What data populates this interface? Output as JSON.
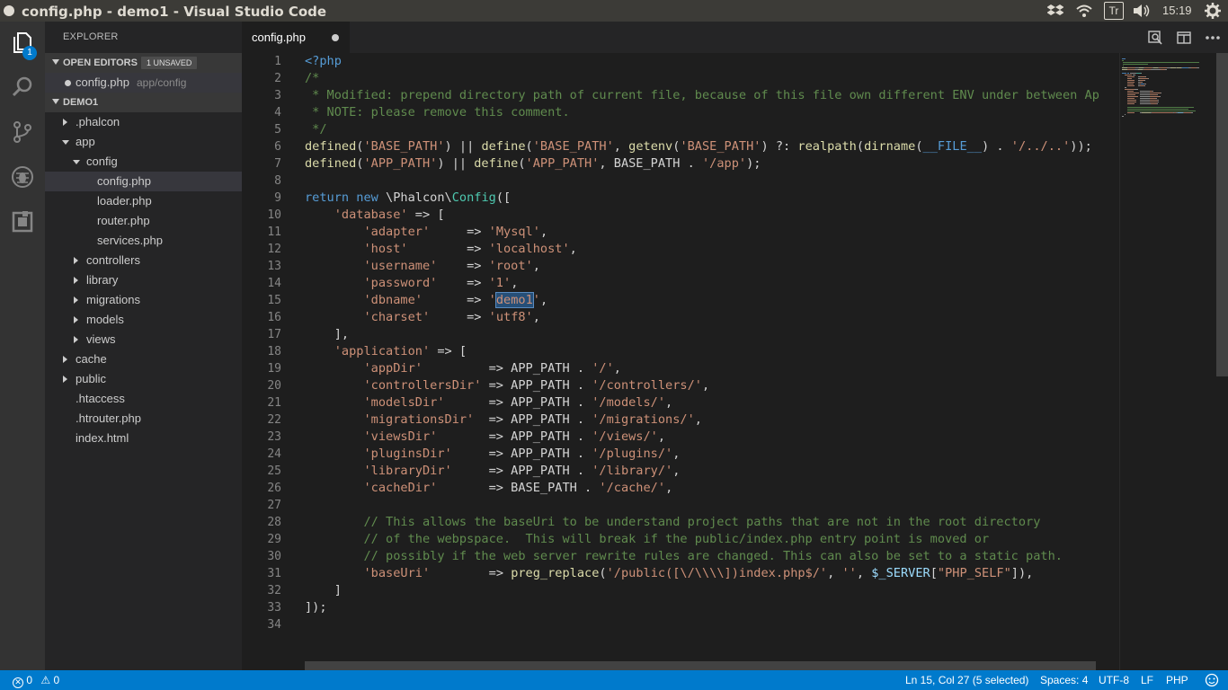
{
  "window": {
    "title": "config.php - demo1 - Visual Studio Code"
  },
  "system_tray": {
    "time": "15:19",
    "keyboard_indicator": "Tr"
  },
  "activity_bar": {
    "explorer_badge": "1",
    "icons": [
      "files-icon",
      "search-icon",
      "source-control-icon",
      "debug-icon",
      "extensions-icon"
    ]
  },
  "sidebar": {
    "header": "EXPLORER",
    "open_editors": {
      "label": "OPEN EDITORS",
      "badge": "1 UNSAVED",
      "file": "config.php",
      "path": "app/config"
    },
    "project": {
      "label": "DEMO1",
      "items": [
        {
          "name": ".phalcon"
        },
        {
          "name": "app"
        },
        {
          "name": "config"
        },
        {
          "name": "config.php"
        },
        {
          "name": "loader.php"
        },
        {
          "name": "router.php"
        },
        {
          "name": "services.php"
        },
        {
          "name": "controllers"
        },
        {
          "name": "library"
        },
        {
          "name": "migrations"
        },
        {
          "name": "models"
        },
        {
          "name": "views"
        },
        {
          "name": "cache"
        },
        {
          "name": "public"
        },
        {
          "name": ".htaccess"
        },
        {
          "name": ".htrouter.php"
        },
        {
          "name": "index.html"
        }
      ]
    }
  },
  "tabs": [
    {
      "label": "config.php",
      "dirty": true
    }
  ],
  "editor": {
    "line_numbers": [
      "1",
      "2",
      "3",
      "4",
      "5",
      "6",
      "7",
      "8",
      "9",
      "10",
      "11",
      "12",
      "13",
      "14",
      "15",
      "16",
      "17",
      "18",
      "19",
      "20",
      "21",
      "22",
      "23",
      "24",
      "25",
      "26",
      "27",
      "28",
      "29",
      "30",
      "31",
      "32",
      "33",
      "34"
    ],
    "lines": [
      [
        [
          "kw",
          "<?php"
        ]
      ],
      [
        [
          "cm",
          "/*"
        ]
      ],
      [
        [
          "cm",
          " * Modified: prepend directory path of current file, because of this file own different ENV under between Ap"
        ]
      ],
      [
        [
          "cm",
          " * NOTE: please remove this comment."
        ]
      ],
      [
        [
          "cm",
          " */"
        ]
      ],
      [
        [
          "fn",
          "defined"
        ],
        [
          "tx",
          "("
        ],
        [
          "st",
          "'BASE_PATH'"
        ],
        [
          "tx",
          ") || "
        ],
        [
          "fn",
          "define"
        ],
        [
          "tx",
          "("
        ],
        [
          "st",
          "'BASE_PATH'"
        ],
        [
          "tx",
          ", "
        ],
        [
          "fn",
          "getenv"
        ],
        [
          "tx",
          "("
        ],
        [
          "st",
          "'BASE_PATH'"
        ],
        [
          "tx",
          ") ?: "
        ],
        [
          "fn",
          "realpath"
        ],
        [
          "tx",
          "("
        ],
        [
          "fn",
          "dirname"
        ],
        [
          "tx",
          "("
        ],
        [
          "kw",
          "__FILE__"
        ],
        [
          "tx",
          ") . "
        ],
        [
          "st",
          "'/../..'"
        ],
        [
          "tx",
          "));"
        ]
      ],
      [
        [
          "fn",
          "defined"
        ],
        [
          "tx",
          "("
        ],
        [
          "st",
          "'APP_PATH'"
        ],
        [
          "tx",
          ") || "
        ],
        [
          "fn",
          "define"
        ],
        [
          "tx",
          "("
        ],
        [
          "st",
          "'APP_PATH'"
        ],
        [
          "tx",
          ", BASE_PATH . "
        ],
        [
          "st",
          "'/app'"
        ],
        [
          "tx",
          ");"
        ]
      ],
      [],
      [
        [
          "kw",
          "return"
        ],
        [
          "tx",
          " "
        ],
        [
          "kw",
          "new"
        ],
        [
          "tx",
          " \\Phalcon\\"
        ],
        [
          "cl",
          "Config"
        ],
        [
          "tx",
          "(["
        ]
      ],
      [
        [
          "tx",
          "    "
        ],
        [
          "st",
          "'database'"
        ],
        [
          "tx",
          " => ["
        ]
      ],
      [
        [
          "tx",
          "        "
        ],
        [
          "st",
          "'adapter'"
        ],
        [
          "tx",
          "     => "
        ],
        [
          "st",
          "'Mysql'"
        ],
        [
          "tx",
          ","
        ]
      ],
      [
        [
          "tx",
          "        "
        ],
        [
          "st",
          "'host'"
        ],
        [
          "tx",
          "        => "
        ],
        [
          "st",
          "'localhost'"
        ],
        [
          "tx",
          ","
        ]
      ],
      [
        [
          "tx",
          "        "
        ],
        [
          "st",
          "'username'"
        ],
        [
          "tx",
          "    => "
        ],
        [
          "st",
          "'root'"
        ],
        [
          "tx",
          ","
        ]
      ],
      [
        [
          "tx",
          "        "
        ],
        [
          "st",
          "'password'"
        ],
        [
          "tx",
          "    => "
        ],
        [
          "st",
          "'1'"
        ],
        [
          "tx",
          ","
        ]
      ],
      [
        [
          "tx",
          "        "
        ],
        [
          "st",
          "'dbname'"
        ],
        [
          "tx",
          "      => "
        ],
        [
          "st",
          "'"
        ],
        [
          "sel",
          "demo1"
        ],
        [
          "st",
          "'"
        ],
        [
          "tx",
          ","
        ]
      ],
      [
        [
          "tx",
          "        "
        ],
        [
          "st",
          "'charset'"
        ],
        [
          "tx",
          "     => "
        ],
        [
          "st",
          "'utf8'"
        ],
        [
          "tx",
          ","
        ]
      ],
      [
        [
          "tx",
          "    ],"
        ]
      ],
      [
        [
          "tx",
          "    "
        ],
        [
          "st",
          "'application'"
        ],
        [
          "tx",
          " => ["
        ]
      ],
      [
        [
          "tx",
          "        "
        ],
        [
          "st",
          "'appDir'"
        ],
        [
          "tx",
          "         => APP_PATH . "
        ],
        [
          "st",
          "'/'"
        ],
        [
          "tx",
          ","
        ]
      ],
      [
        [
          "tx",
          "        "
        ],
        [
          "st",
          "'controllersDir'"
        ],
        [
          "tx",
          " => APP_PATH . "
        ],
        [
          "st",
          "'/controllers/'"
        ],
        [
          "tx",
          ","
        ]
      ],
      [
        [
          "tx",
          "        "
        ],
        [
          "st",
          "'modelsDir'"
        ],
        [
          "tx",
          "      => APP_PATH . "
        ],
        [
          "st",
          "'/models/'"
        ],
        [
          "tx",
          ","
        ]
      ],
      [
        [
          "tx",
          "        "
        ],
        [
          "st",
          "'migrationsDir'"
        ],
        [
          "tx",
          "  => APP_PATH . "
        ],
        [
          "st",
          "'/migrations/'"
        ],
        [
          "tx",
          ","
        ]
      ],
      [
        [
          "tx",
          "        "
        ],
        [
          "st",
          "'viewsDir'"
        ],
        [
          "tx",
          "       => APP_PATH . "
        ],
        [
          "st",
          "'/views/'"
        ],
        [
          "tx",
          ","
        ]
      ],
      [
        [
          "tx",
          "        "
        ],
        [
          "st",
          "'pluginsDir'"
        ],
        [
          "tx",
          "     => APP_PATH . "
        ],
        [
          "st",
          "'/plugins/'"
        ],
        [
          "tx",
          ","
        ]
      ],
      [
        [
          "tx",
          "        "
        ],
        [
          "st",
          "'libraryDir'"
        ],
        [
          "tx",
          "     => APP_PATH . "
        ],
        [
          "st",
          "'/library/'"
        ],
        [
          "tx",
          ","
        ]
      ],
      [
        [
          "tx",
          "        "
        ],
        [
          "st",
          "'cacheDir'"
        ],
        [
          "tx",
          "       => BASE_PATH . "
        ],
        [
          "st",
          "'/cache/'"
        ],
        [
          "tx",
          ","
        ]
      ],
      [],
      [
        [
          "cm",
          "        // This allows the baseUri to be understand project paths that are not in the root directory"
        ]
      ],
      [
        [
          "cm",
          "        // of the webpspace.  This will break if the public/index.php entry point is moved or"
        ]
      ],
      [
        [
          "cm",
          "        // possibly if the web server rewrite rules are changed. This can also be set to a static path."
        ]
      ],
      [
        [
          "tx",
          "        "
        ],
        [
          "st",
          "'baseUri'"
        ],
        [
          "tx",
          "        => "
        ],
        [
          "fn",
          "preg_replace"
        ],
        [
          "tx",
          "("
        ],
        [
          "st",
          "'/public([\\/\\\\\\\\])index.php$/'"
        ],
        [
          "tx",
          ", "
        ],
        [
          "st",
          "''"
        ],
        [
          "tx",
          ", "
        ],
        [
          "vr",
          "$_SERVER"
        ],
        [
          "tx",
          "["
        ],
        [
          "st",
          "\"PHP_SELF\""
        ],
        [
          "tx",
          "]),"
        ]
      ],
      [
        [
          "tx",
          "    ]"
        ]
      ],
      [
        [
          "tx",
          "]);"
        ]
      ],
      []
    ]
  },
  "status_bar": {
    "errors": "0",
    "warnings": "0",
    "position": "Ln 15, Col 27 (5 selected)",
    "indent": "Spaces: 4",
    "encoding": "UTF-8",
    "eol": "LF",
    "language": "PHP"
  },
  "colors": {
    "accent": "#007acc",
    "editor_bg": "#1e1e1e",
    "sidebar_bg": "#252526"
  }
}
